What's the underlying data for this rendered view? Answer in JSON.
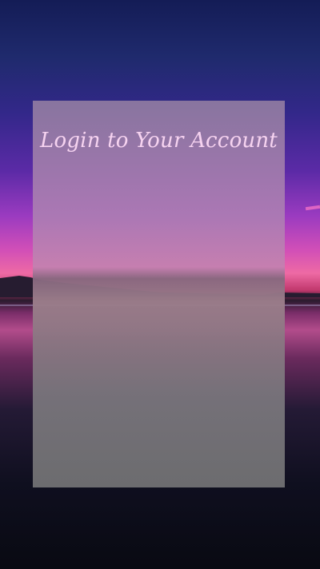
{
  "login": {
    "title": "Login to Your Account"
  },
  "colors": {
    "title_text": "#f6d3f0",
    "card_overlay": "#8c7aa0"
  }
}
